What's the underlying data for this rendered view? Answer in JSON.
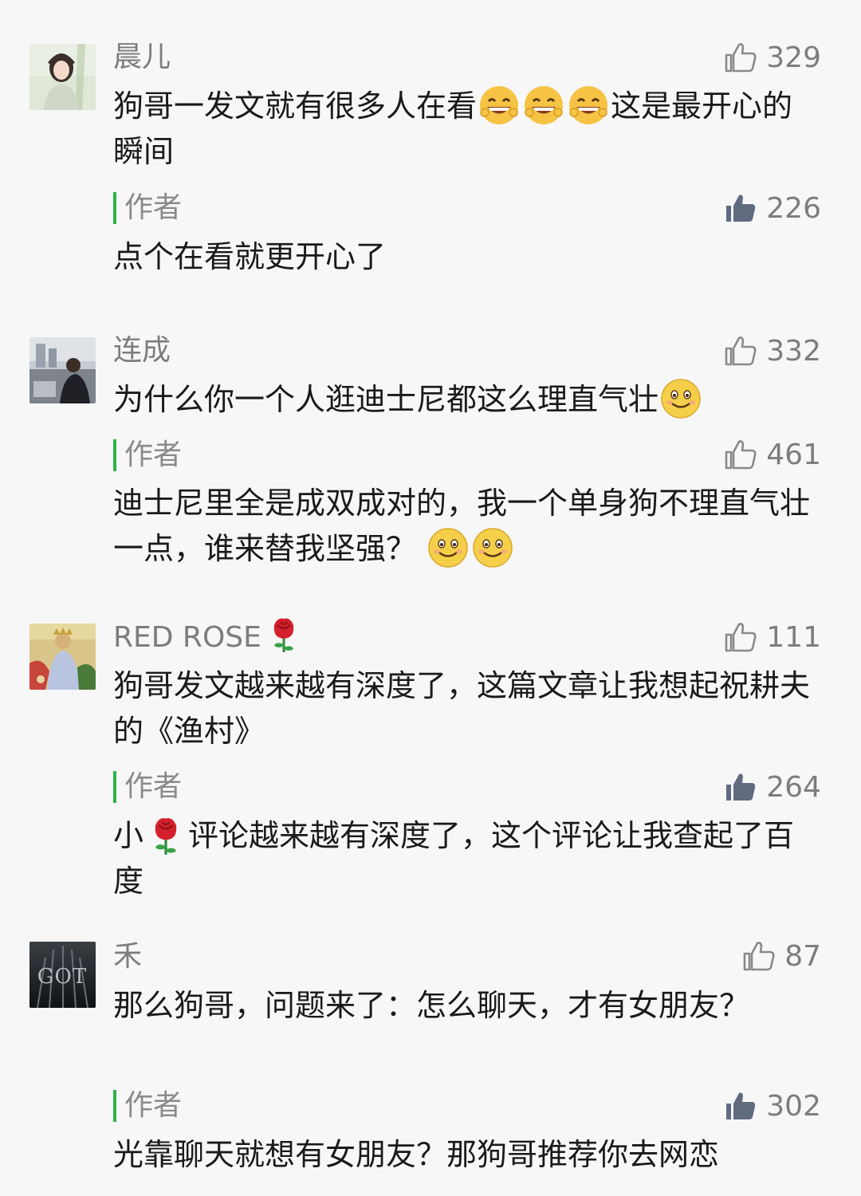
{
  "colors": {
    "background": "#f7f7f7",
    "author_bar": "#2fb34a",
    "meta_text": "#7d7d7d"
  },
  "author_label": "作者",
  "comments": [
    {
      "nickname": "晨儿",
      "likes": "329",
      "text_a": "狗哥一发文就有很多人在看",
      "emoji_a": [
        "grin-emoji",
        "grin-emoji",
        "grin-emoji"
      ],
      "text_b": "这是最开心的瞬间",
      "reply": {
        "likes": "226",
        "text": "点个在看就更开心了"
      }
    },
    {
      "nickname": "连成",
      "likes": "332",
      "text_a": "为什么你一个人逛迪士尼都这么理直气壮",
      "emoji_a": [
        "smile-emoji"
      ],
      "reply": {
        "likes": "461",
        "text": "迪士尼里全是成双成对的，我一个单身狗不理直气壮一点，谁来替我坚强？",
        "emoji": [
          "smile-emoji",
          "smile-emoji"
        ]
      }
    },
    {
      "nickname": "RED ROSE",
      "nickname_icon": "rose-icon",
      "likes": "111",
      "text_a": "狗哥发文越来越有深度了，这篇文章让我想起祝耕夫的《渔村》",
      "reply": {
        "likes": "264",
        "text_pre": "小",
        "icon": "rose-icon",
        "text": "评论越来越有深度了，这个评论让我查起了百度"
      }
    },
    {
      "nickname": "禾",
      "avatar_text": "GOT",
      "likes": "87",
      "text_a": "那么狗哥，问题来了：怎么聊天，才有女朋友？",
      "reply": {
        "likes": "302",
        "text": "光靠聊天就想有女朋友？那狗哥推荐你去网恋"
      }
    }
  ]
}
